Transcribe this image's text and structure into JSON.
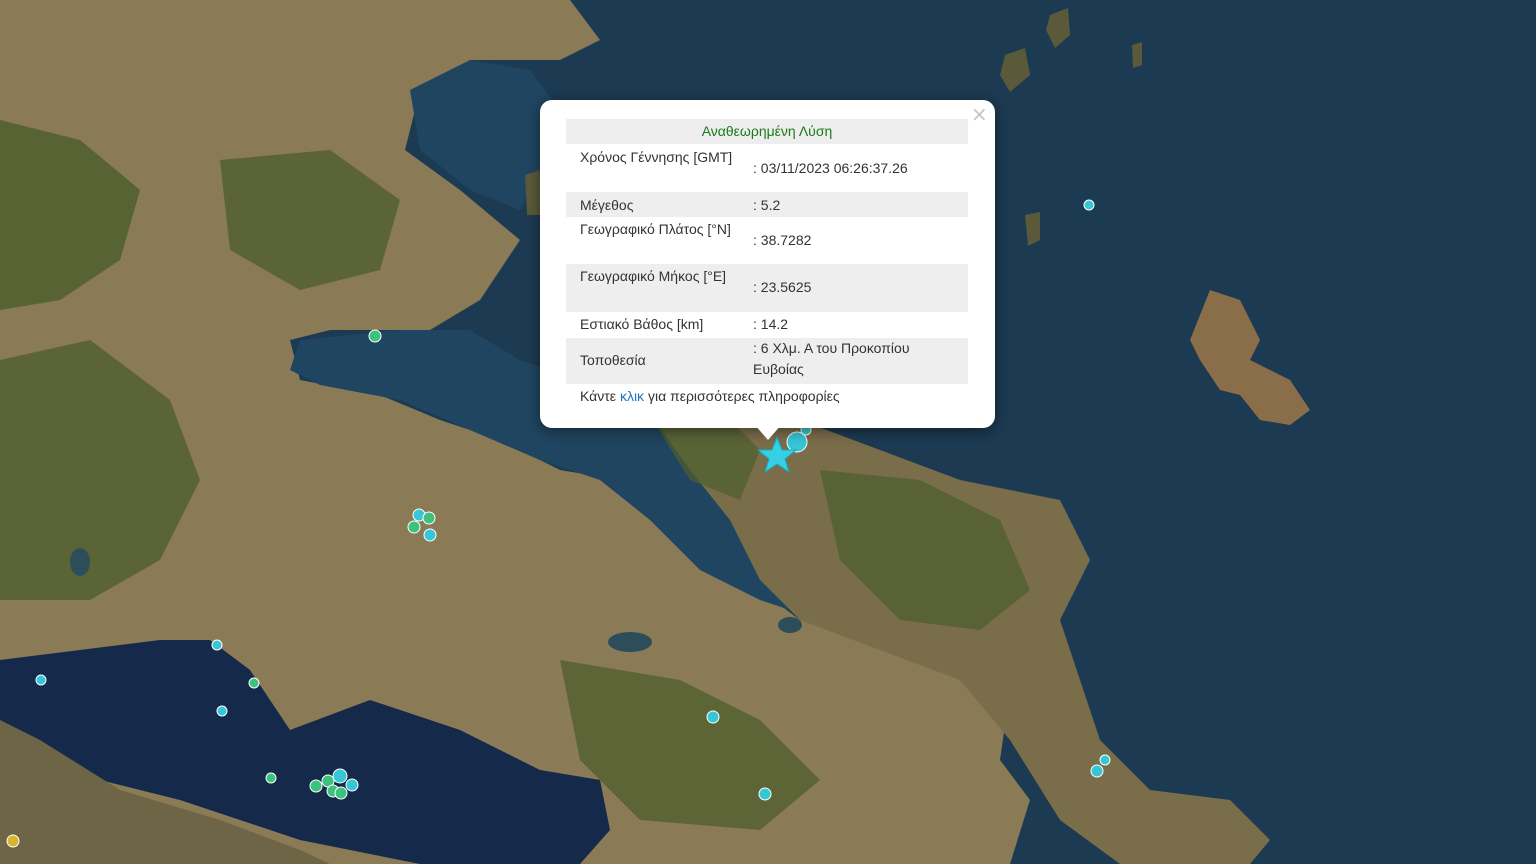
{
  "map": {
    "colors": {
      "sea": "#1c3a52",
      "deep_sea": "#15294a",
      "land": "#8a7a55",
      "forest": "#4d5f2e",
      "mountain": "#6d6546",
      "lake": "#2e4d5a"
    },
    "epicenter_icon": "star-marker-icon",
    "epicenter_color": "#36d0e6",
    "event_colors": [
      "#37c6d5",
      "#3cc27e",
      "#d8b431"
    ]
  },
  "popup": {
    "close_label": "×",
    "title": "Αναθεωρημένη Λύση",
    "rows": [
      {
        "label": "Χρόνος Γέννησης [GMT]",
        "value": ": 03/11/2023 06:26:37.26"
      },
      {
        "label": "Μέγεθος",
        "value": ": 5.2"
      },
      {
        "label": "Γεωγραφικό Πλάτος [°N]",
        "value": ": 38.7282"
      },
      {
        "label": "Γεωγραφικό Μήκος [°E]",
        "value": ": 23.5625"
      },
      {
        "label": "Εστιακό Βάθος [km]",
        "value": ": 14.2"
      },
      {
        "label": "Τοποθεσία",
        "value": ": 6 Χλμ. Α του Προκοπίου Ευβοίας"
      }
    ],
    "more_prefix": "Κάντε",
    "more_link": "κλικ",
    "more_suffix": "για περισσότερες πληροφορίες"
  }
}
